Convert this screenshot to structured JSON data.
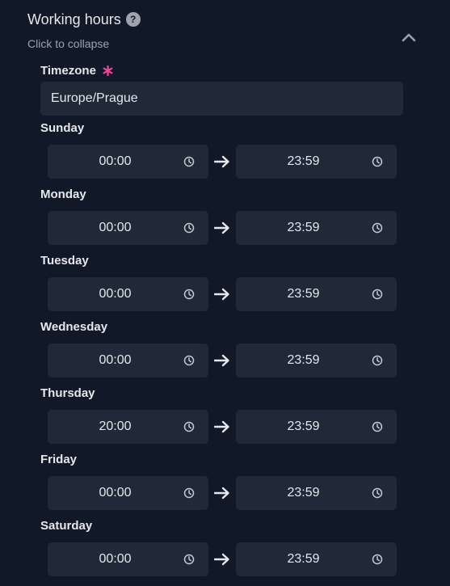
{
  "header": {
    "title": "Working hours",
    "help_icon": "help-icon",
    "help_glyph": "?",
    "subtitle": "Click to collapse",
    "collapse_icon": "chevron-up-icon"
  },
  "timezone": {
    "label": "Timezone",
    "required_mark": "*",
    "value": "Europe/Prague"
  },
  "days": [
    {
      "label": "Sunday",
      "start": "00:00",
      "end": "23:59"
    },
    {
      "label": "Monday",
      "start": "00:00",
      "end": "23:59"
    },
    {
      "label": "Tuesday",
      "start": "00:00",
      "end": "23:59"
    },
    {
      "label": "Wednesday",
      "start": "00:00",
      "end": "23:59"
    },
    {
      "label": "Thursday",
      "start": "20:00",
      "end": "23:59"
    },
    {
      "label": "Friday",
      "start": "00:00",
      "end": "23:59"
    },
    {
      "label": "Saturday",
      "start": "00:00",
      "end": "23:59"
    }
  ],
  "icons": {
    "clock": "clock-icon",
    "arrow": "arrow-right-icon"
  },
  "colors": {
    "background": "#111827",
    "input_background": "#1f2937",
    "text": "#e5e7eb",
    "muted_text": "#9ca3af",
    "required": "#ec4899"
  }
}
